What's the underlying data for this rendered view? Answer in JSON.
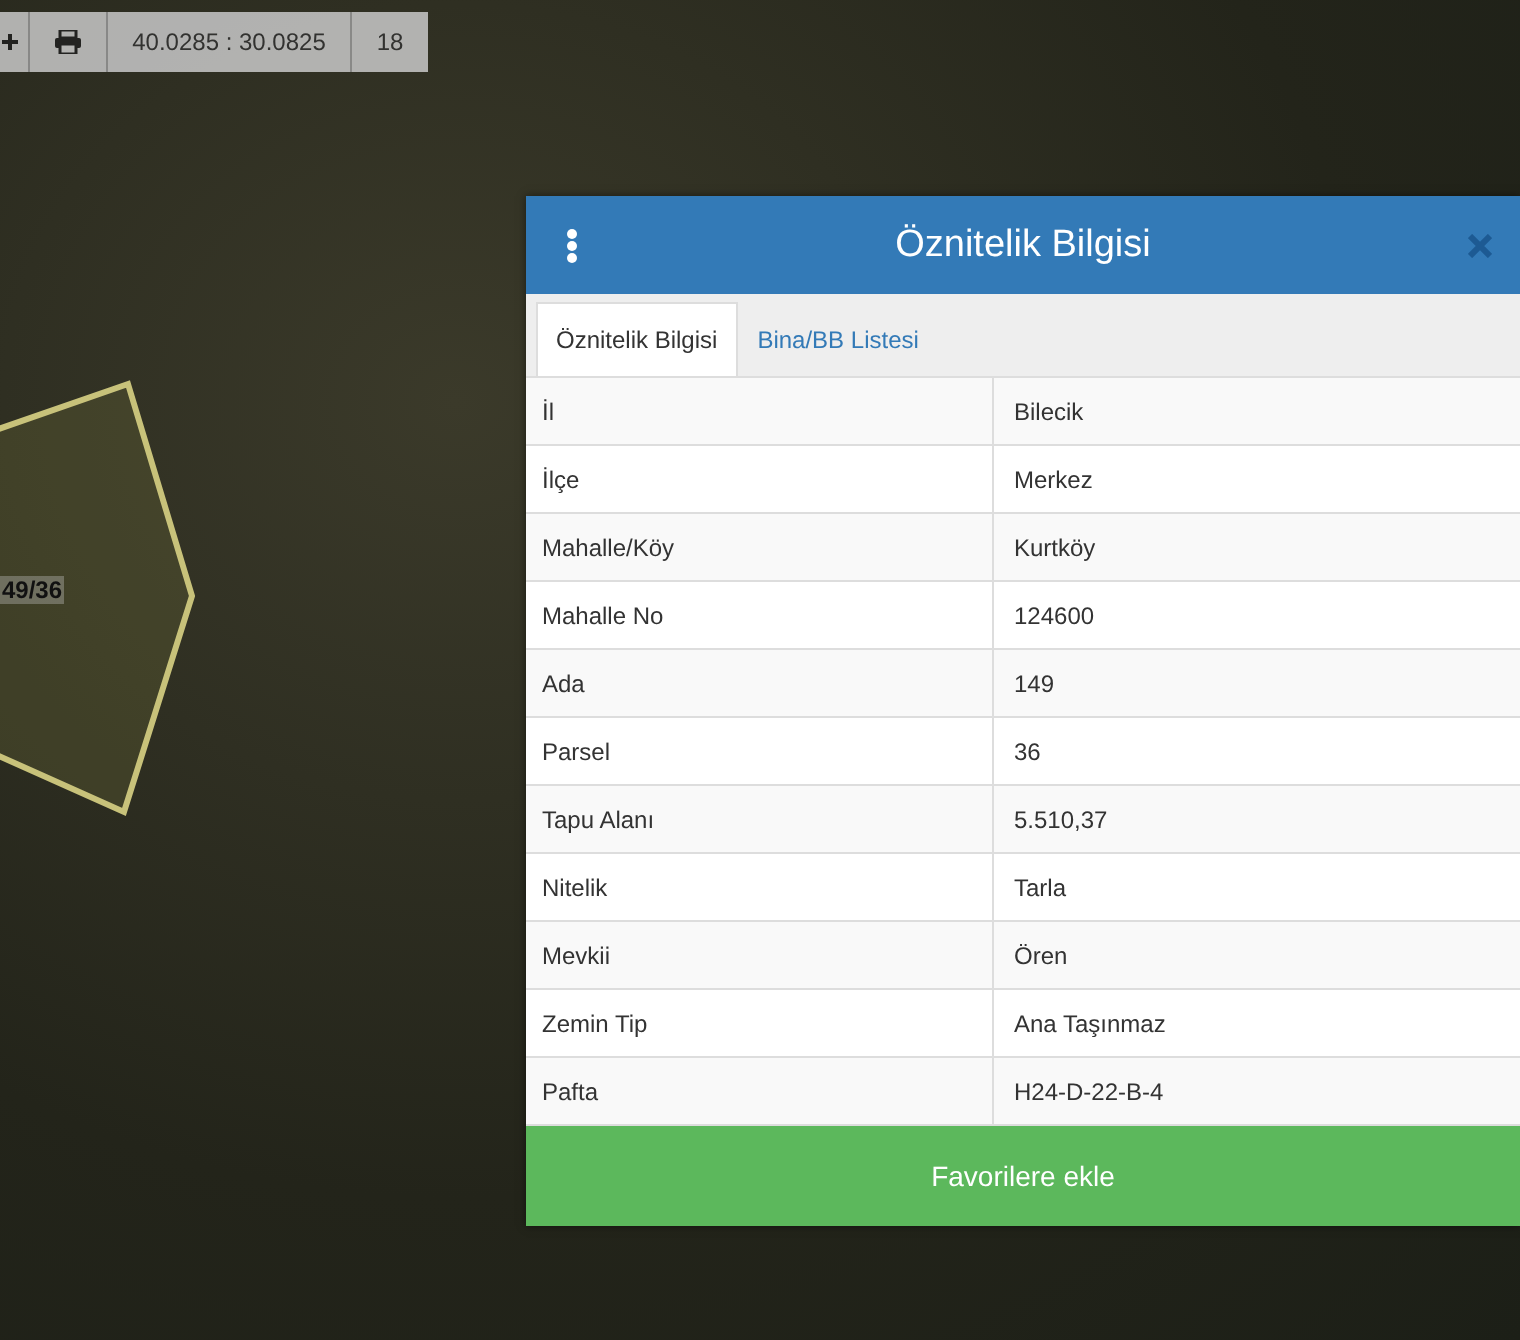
{
  "toolbar": {
    "coordinates": "40.0285 : 30.0825",
    "zoom_level": "18"
  },
  "map": {
    "parcel_label": "49/36"
  },
  "panel": {
    "title": "Öznitelik Bilgisi",
    "tabs": [
      {
        "label": "Öznitelik Bilgisi",
        "selected": true
      },
      {
        "label": "Bina/BB Listesi",
        "selected": false
      }
    ],
    "rows": [
      {
        "label": "İl",
        "value": "Bilecik"
      },
      {
        "label": "İlçe",
        "value": "Merkez"
      },
      {
        "label": "Mahalle/Köy",
        "value": "Kurtköy"
      },
      {
        "label": "Mahalle No",
        "value": "124600"
      },
      {
        "label": "Ada",
        "value": "149"
      },
      {
        "label": "Parsel",
        "value": "36"
      },
      {
        "label": "Tapu Alanı",
        "value": "5.510,37"
      },
      {
        "label": "Nitelik",
        "value": "Tarla"
      },
      {
        "label": "Mevkii",
        "value": "Ören"
      },
      {
        "label": "Zemin Tip",
        "value": "Ana Taşınmaz"
      },
      {
        "label": "Pafta",
        "value": "H24-D-22-B-4"
      }
    ],
    "button": "Favorilere ekle"
  }
}
